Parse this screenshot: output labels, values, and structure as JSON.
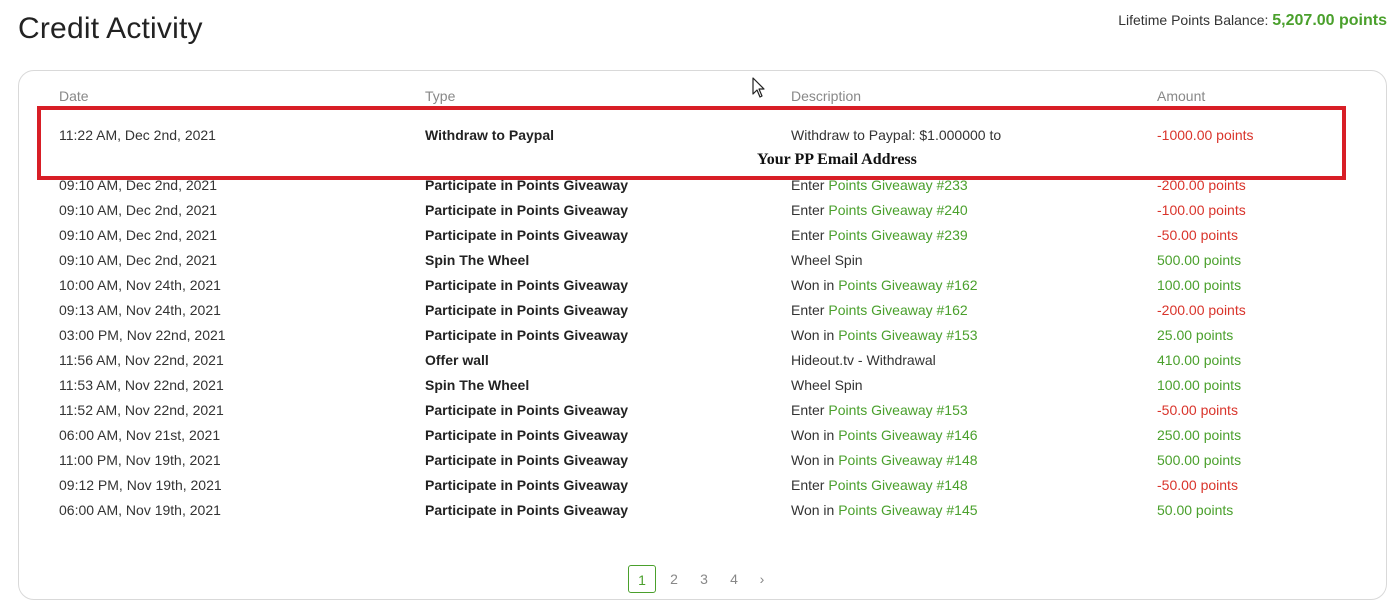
{
  "page": {
    "title": "Credit Activity"
  },
  "balance": {
    "label": "Lifetime Points Balance:",
    "value": "5,207.00 points"
  },
  "columns": {
    "date": "Date",
    "type": "Type",
    "description": "Description",
    "amount": "Amount"
  },
  "highlight_note": "Your PP Email Address",
  "rows": [
    {
      "date": "11:22 AM, Dec 2nd, 2021",
      "type": "Withdraw to Paypal",
      "desc_prefix": "Withdraw to Paypal: $1.000000 to",
      "desc_link": "",
      "amount": "-1000.00 points",
      "sign": "neg"
    },
    {
      "date": "09:10 AM, Dec 2nd, 2021",
      "type": "Participate in Points Giveaway",
      "desc_prefix": "Enter",
      "desc_link": "Points Giveaway #233",
      "amount": "-200.00 points",
      "sign": "neg"
    },
    {
      "date": "09:10 AM, Dec 2nd, 2021",
      "type": "Participate in Points Giveaway",
      "desc_prefix": "Enter",
      "desc_link": "Points Giveaway #240",
      "amount": "-100.00 points",
      "sign": "neg"
    },
    {
      "date": "09:10 AM, Dec 2nd, 2021",
      "type": "Participate in Points Giveaway",
      "desc_prefix": "Enter",
      "desc_link": "Points Giveaway #239",
      "amount": "-50.00 points",
      "sign": "neg"
    },
    {
      "date": "09:10 AM, Dec 2nd, 2021",
      "type": "Spin The Wheel",
      "desc_prefix": "Wheel Spin",
      "desc_link": "",
      "amount": "500.00 points",
      "sign": "pos"
    },
    {
      "date": "10:00 AM, Nov 24th, 2021",
      "type": "Participate in Points Giveaway",
      "desc_prefix": "Won in",
      "desc_link": "Points Giveaway #162",
      "amount": "100.00 points",
      "sign": "pos"
    },
    {
      "date": "09:13 AM, Nov 24th, 2021",
      "type": "Participate in Points Giveaway",
      "desc_prefix": "Enter",
      "desc_link": "Points Giveaway #162",
      "amount": "-200.00 points",
      "sign": "neg"
    },
    {
      "date": "03:00 PM, Nov 22nd, 2021",
      "type": "Participate in Points Giveaway",
      "desc_prefix": "Won in",
      "desc_link": "Points Giveaway #153",
      "amount": "25.00 points",
      "sign": "pos"
    },
    {
      "date": "11:56 AM, Nov 22nd, 2021",
      "type": "Offer wall",
      "desc_prefix": "Hideout.tv - Withdrawal",
      "desc_link": "",
      "amount": "410.00 points",
      "sign": "pos"
    },
    {
      "date": "11:53 AM, Nov 22nd, 2021",
      "type": "Spin The Wheel",
      "desc_prefix": "Wheel Spin",
      "desc_link": "",
      "amount": "100.00 points",
      "sign": "pos"
    },
    {
      "date": "11:52 AM, Nov 22nd, 2021",
      "type": "Participate in Points Giveaway",
      "desc_prefix": "Enter",
      "desc_link": "Points Giveaway #153",
      "amount": "-50.00 points",
      "sign": "neg"
    },
    {
      "date": "06:00 AM, Nov 21st, 2021",
      "type": "Participate in Points Giveaway",
      "desc_prefix": "Won in",
      "desc_link": "Points Giveaway #146",
      "amount": "250.00 points",
      "sign": "pos"
    },
    {
      "date": "11:00 PM, Nov 19th, 2021",
      "type": "Participate in Points Giveaway",
      "desc_prefix": "Won in",
      "desc_link": "Points Giveaway #148",
      "amount": "500.00 points",
      "sign": "pos"
    },
    {
      "date": "09:12 PM, Nov 19th, 2021",
      "type": "Participate in Points Giveaway",
      "desc_prefix": "Enter",
      "desc_link": "Points Giveaway #148",
      "amount": "-50.00 points",
      "sign": "neg"
    },
    {
      "date": "06:00 AM, Nov 19th, 2021",
      "type": "Participate in Points Giveaway",
      "desc_prefix": "Won in",
      "desc_link": "Points Giveaway #145",
      "amount": "50.00 points",
      "sign": "pos"
    }
  ],
  "pagination": {
    "pages": [
      "1",
      "2",
      "3",
      "4"
    ],
    "current": "1",
    "next": "›"
  },
  "colors": {
    "positive": "#4aa02c",
    "negative": "#d9342b",
    "highlight": "#d81e26"
  }
}
